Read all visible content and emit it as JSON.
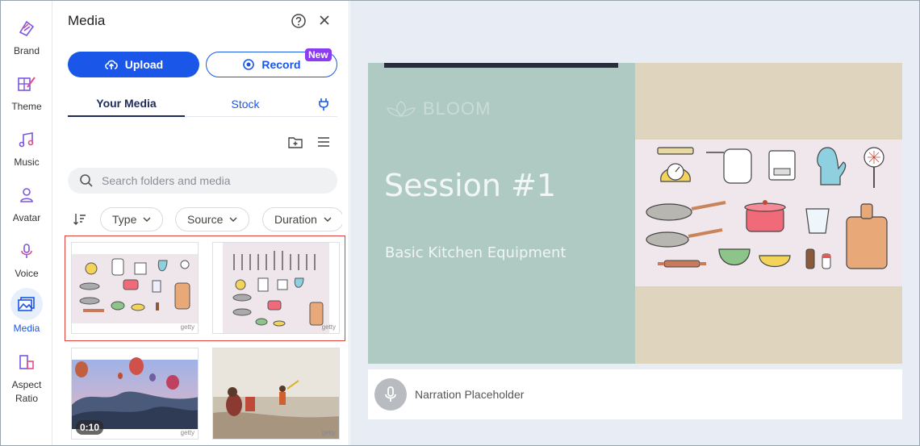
{
  "rail": {
    "items": [
      {
        "label": "Brand"
      },
      {
        "label": "Theme"
      },
      {
        "label": "Music"
      },
      {
        "label": "Avatar"
      },
      {
        "label": "Voice"
      },
      {
        "label": "Media",
        "active": true
      },
      {
        "label": "Aspect\nRatio"
      }
    ]
  },
  "panel": {
    "title": "Media",
    "upload_label": "Upload",
    "record_label": "Record",
    "new_badge": "New",
    "tabs": [
      {
        "label": "Your Media",
        "active": true
      },
      {
        "label": "Stock"
      }
    ],
    "search_placeholder": "Search folders and media",
    "filters": [
      {
        "label": "Type"
      },
      {
        "label": "Source"
      },
      {
        "label": "Duration"
      }
    ],
    "media": [
      {
        "kind": "image",
        "watermark": "getty",
        "selected": true
      },
      {
        "kind": "image",
        "watermark": "getty",
        "selected": true
      },
      {
        "kind": "video",
        "duration": "0:10",
        "watermark": "getty"
      },
      {
        "kind": "image",
        "watermark": "getty"
      }
    ]
  },
  "slide": {
    "brand": "BLOOM",
    "title": "Session #1",
    "subtitle": "Basic Kitchen Equipment"
  },
  "narration": {
    "placeholder": "Narration Placeholder"
  },
  "colors": {
    "accent": "#1a56e8",
    "selection": "#e0413b",
    "new_badge": "#8b3cf0",
    "slide_teal": "#aecac3",
    "slide_beige": "#dfd5bf"
  }
}
